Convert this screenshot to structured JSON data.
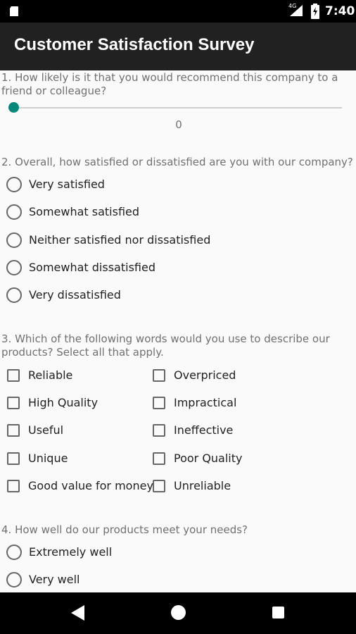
{
  "status_bar": {
    "time": "7:40",
    "network": "4G"
  },
  "app_bar": {
    "title": "Customer Satisfaction Survey"
  },
  "questions": {
    "q1": {
      "text": "1. How likely is it that you would recommend this company to a friend or colleague?",
      "slider_value": "0"
    },
    "q2": {
      "text": "2. Overall, how satisfied or dissatisfied are you with our company?",
      "options": [
        "Very satisfied",
        "Somewhat satisfied",
        "Neither satisfied nor dissatisfied",
        "Somewhat dissatisfied",
        "Very dissatisfied"
      ]
    },
    "q3": {
      "text": "3. Which of the following words would you use to describe our products? Select all that apply.",
      "options_left": [
        "Reliable",
        "High Quality",
        "Useful",
        "Unique",
        "Good value for money"
      ],
      "options_right": [
        "Overpriced",
        "Impractical",
        "Ineffective",
        "Poor Quality",
        "Unreliable"
      ]
    },
    "q4": {
      "text": "4. How well do our products meet your needs?",
      "options": [
        "Extremely well",
        "Very well"
      ]
    }
  },
  "colors": {
    "accent": "#00897b",
    "app_bar": "#212121",
    "status_bar": "#000000"
  }
}
